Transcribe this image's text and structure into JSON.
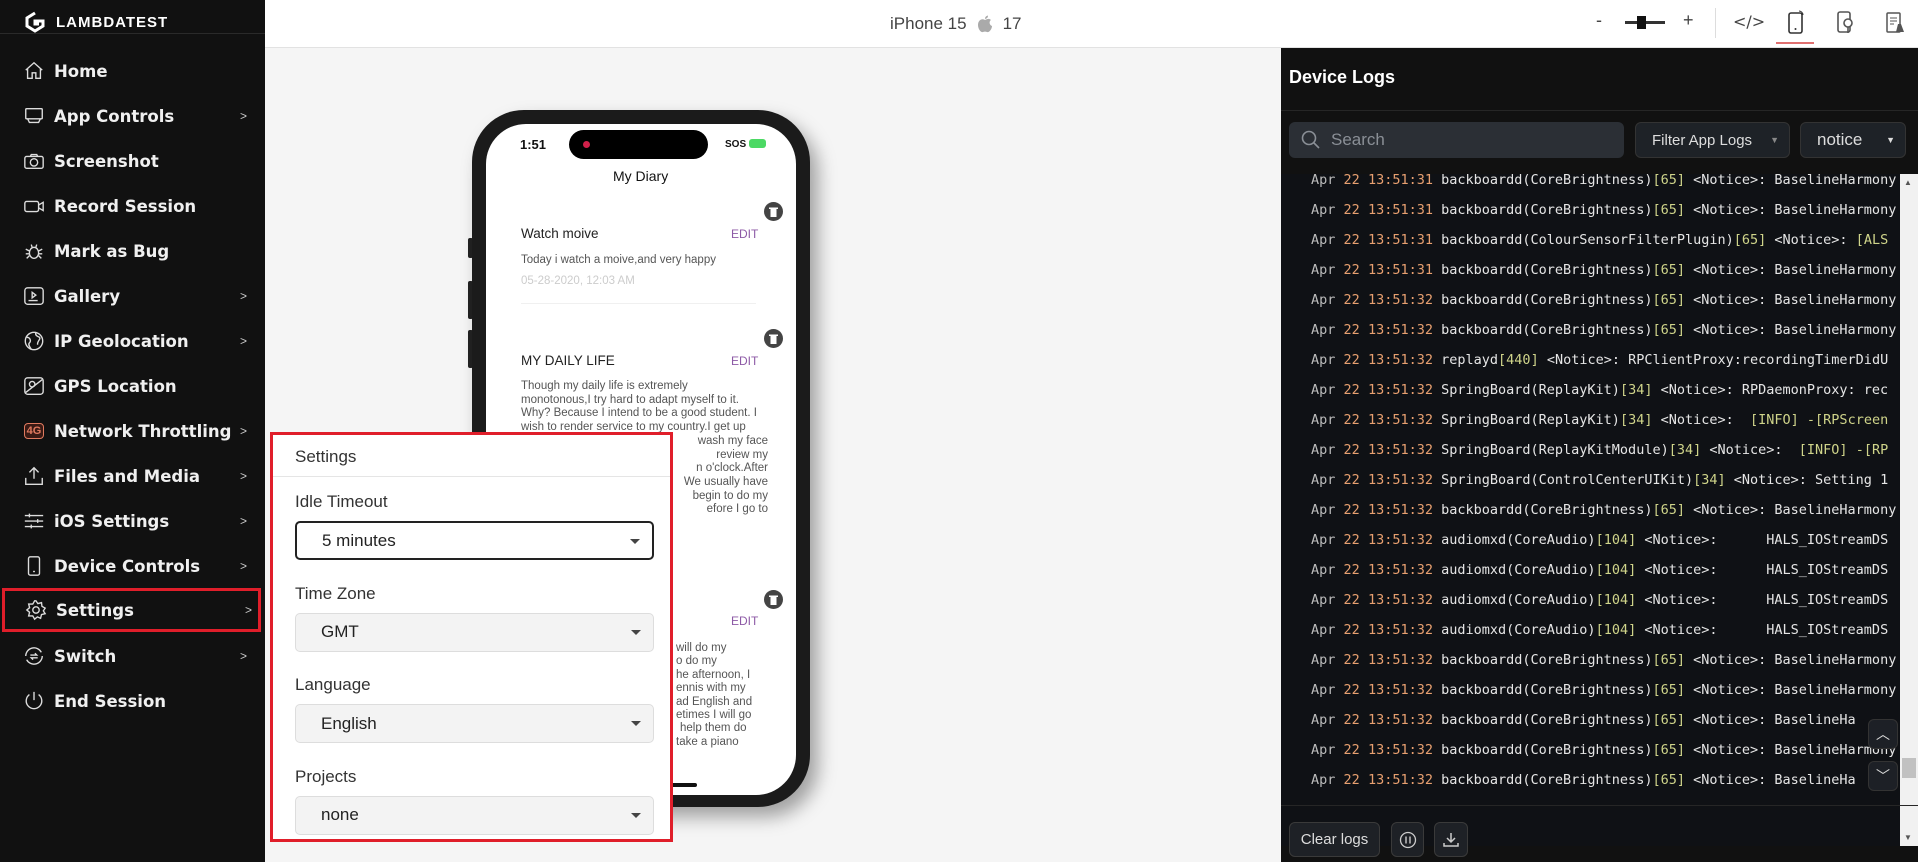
{
  "brand": "LAMBDATEST",
  "sidebar": {
    "items": [
      {
        "label": "Home",
        "icon": "home-icon",
        "chevron": false
      },
      {
        "label": "App Controls",
        "icon": "app-controls-icon",
        "chevron": true
      },
      {
        "label": "Screenshot",
        "icon": "camera-icon",
        "chevron": false
      },
      {
        "label": "Record Session",
        "icon": "video-camera-icon",
        "chevron": false
      },
      {
        "label": "Mark as Bug",
        "icon": "bug-icon",
        "chevron": false
      },
      {
        "label": "Gallery",
        "icon": "gallery-icon",
        "chevron": true
      },
      {
        "label": "IP Geolocation",
        "icon": "globe-icon",
        "chevron": true
      },
      {
        "label": "GPS Location",
        "icon": "map-pin-icon",
        "chevron": false
      },
      {
        "label": "Network Throttling",
        "icon": "network-4g-icon",
        "chevron": true,
        "badge": "4G"
      },
      {
        "label": "Files and Media",
        "icon": "upload-icon",
        "chevron": true
      },
      {
        "label": "iOS Settings",
        "icon": "sliders-icon",
        "chevron": true
      },
      {
        "label": "Device Controls",
        "icon": "device-icon",
        "chevron": true
      },
      {
        "label": "Settings",
        "icon": "gear-icon",
        "chevron": true,
        "active": true
      },
      {
        "label": "Switch",
        "icon": "switch-icon",
        "chevron": true
      },
      {
        "label": "End Session",
        "icon": "power-icon",
        "chevron": false
      }
    ],
    "chevron_glyph": ">"
  },
  "topbar": {
    "device": "iPhone 15",
    "os_version": "17",
    "zoom_minus": "-",
    "zoom_plus": "+",
    "zoom_level": 0.4
  },
  "phone": {
    "time": "1:51",
    "carrier": "SOS",
    "app_title": "My Diary",
    "cards": [
      {
        "title": "Watch moive",
        "edit": "EDIT",
        "lines": [
          "Today i watch a moive,and very happy"
        ],
        "date": "05-28-2020, 12:03 AM"
      },
      {
        "title": "MY DAILY LIFE",
        "edit": "EDIT",
        "lines": [
          "Though my daily life is extremely",
          "monotonous,I try hard to adapt myself to it.",
          "Why? Because I intend to be a good student. I",
          "wish to render service to my country.I get up"
        ],
        "partial": [
          "wash my face",
          "review my",
          "n o'clock.After",
          "We usually have",
          "begin to do my",
          "efore I go to"
        ]
      },
      {
        "edit": "EDIT",
        "partial": [
          "will do my",
          "o do my",
          "he afternoon, I",
          "ennis with my",
          "ad English and",
          "etimes I will go",
          "help them do",
          "take a piano"
        ]
      }
    ]
  },
  "settings": {
    "title": "Settings",
    "fields": [
      {
        "label": "Idle Timeout",
        "value": "5 minutes"
      },
      {
        "label": "Time Zone",
        "value": "GMT"
      },
      {
        "label": "Language",
        "value": "English"
      },
      {
        "label": "Projects",
        "value": "none"
      }
    ]
  },
  "logs": {
    "title": "Device Logs",
    "search_placeholder": "Search",
    "filter_label": "Filter App Logs",
    "level": "notice",
    "clear_label": "Clear logs",
    "rows": [
      [
        "31",
        "backboardd(CoreBrightness)",
        "65",
        " <Notice>: BaselineHarmony",
        ""
      ],
      [
        "31",
        "backboardd(CoreBrightness)",
        "65",
        " <Notice>: BaselineHarmony",
        ""
      ],
      [
        "31",
        "backboardd(ColourSensorFilterPlugin)",
        "65",
        " <Notice>: ",
        "[ALS"
      ],
      [
        "31",
        "backboardd(CoreBrightness)",
        "65",
        " <Notice>: BaselineHarmony",
        ""
      ],
      [
        "32",
        "backboardd(CoreBrightness)",
        "65",
        " <Notice>: BaselineHarmony",
        ""
      ],
      [
        "32",
        "backboardd(CoreBrightness)",
        "65",
        " <Notice>: BaselineHarmony",
        ""
      ],
      [
        "32",
        "replayd",
        "440",
        " <Notice>: RPClientProxy:recordingTimerDidU",
        ""
      ],
      [
        "32",
        "SpringBoard(ReplayKit)",
        "34",
        " <Notice>: RPDaemonProxy: rec",
        ""
      ],
      [
        "32",
        "SpringBoard(ReplayKit)",
        "34",
        " <Notice>:  ",
        "[INFO] -[RPScreen"
      ],
      [
        "32",
        "SpringBoard(ReplayKitModule)",
        "34",
        " <Notice>:  ",
        "[INFO] -[RP"
      ],
      [
        "32",
        "SpringBoard(ControlCenterUIKit)",
        "34",
        " <Notice>: Setting 1",
        ""
      ],
      [
        "32",
        "backboardd(CoreBrightness)",
        "65",
        " <Notice>: BaselineHarmony",
        ""
      ],
      [
        "32",
        "audiomxd(CoreAudio)",
        "104",
        " <Notice>:      HALS_IOStreamDS",
        ""
      ],
      [
        "32",
        "audiomxd(CoreAudio)",
        "104",
        " <Notice>:      HALS_IOStreamDS",
        ""
      ],
      [
        "32",
        "audiomxd(CoreAudio)",
        "104",
        " <Notice>:      HALS_IOStreamDS",
        ""
      ],
      [
        "32",
        "audiomxd(CoreAudio)",
        "104",
        " <Notice>:      HALS_IOStreamDS",
        ""
      ],
      [
        "32",
        "backboardd(CoreBrightness)",
        "65",
        " <Notice>: BaselineHarmony",
        ""
      ],
      [
        "32",
        "backboardd(CoreBrightness)",
        "65",
        " <Notice>: BaselineHarmony",
        ""
      ],
      [
        "32",
        "backboardd(CoreBrightness)",
        "65",
        " <Notice>: BaselineHa",
        ""
      ],
      [
        "32",
        "backboardd(CoreBrightness)",
        "65",
        " <Notice>: BaselineHarmony",
        ""
      ],
      [
        "32",
        "backboardd(CoreBrightness)",
        "65",
        " <Notice>: BaselineHa",
        ""
      ]
    ],
    "month": "Apr",
    "day": "22",
    "time_prefix": "13:51:"
  },
  "colors": {
    "accent_red": "#e01e2a",
    "log_time": "#e8a070",
    "log_pid": "#cfd48a",
    "edit_purple": "#8d5aa6"
  }
}
